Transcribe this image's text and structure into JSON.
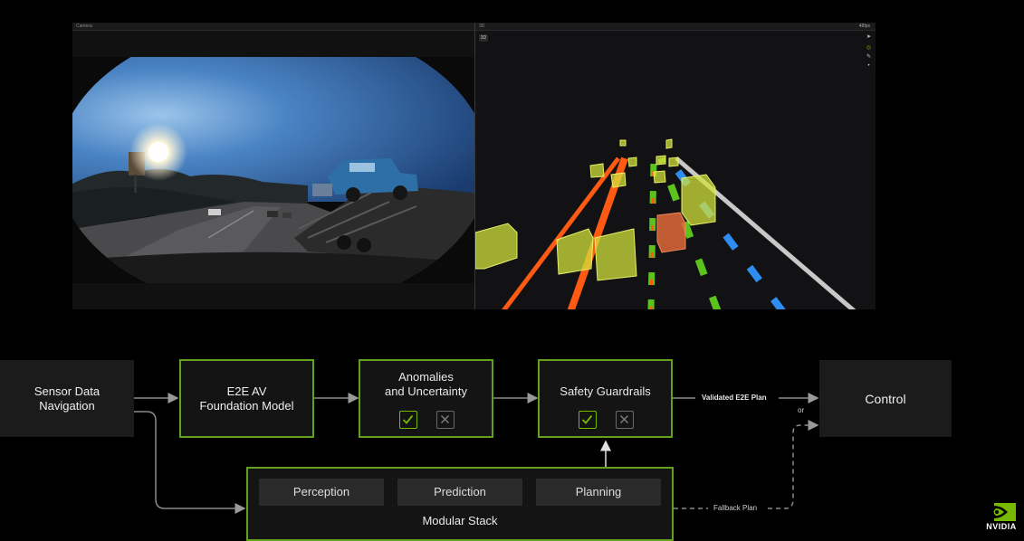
{
  "viewer": {
    "left_panel_title": "Camera",
    "right_panel_title": "3D",
    "right_panel_status": "48fps",
    "right_panel_button": "3D",
    "tools": [
      "pointer-icon",
      "target-icon",
      "ruler-icon",
      "dot-icon"
    ]
  },
  "diagram": {
    "sensor": "Sensor Data\nNavigation",
    "e2e_model": "E2E AV\nFoundation Model",
    "anomalies": "Anomalies\nand Uncertainty",
    "guardrails": "Safety Guardrails",
    "control": "Control",
    "modular_stack": "Modular Stack",
    "perception": "Perception",
    "prediction": "Prediction",
    "planning": "Planning",
    "validated_plan": "Validated E2E Plan",
    "or": "or",
    "fallback_plan": "Fallback Plan"
  },
  "logo": {
    "text": "NVIDIA"
  },
  "colors": {
    "accent_green": "#76b900",
    "box_border_green": "#63a01e",
    "lane_orange": "#ff5a14",
    "lane_green": "#5cc21e",
    "lane_blue": "#2f8df2",
    "bbox_yellow": "#d2e23a",
    "bbox_orange": "#e0683a"
  }
}
